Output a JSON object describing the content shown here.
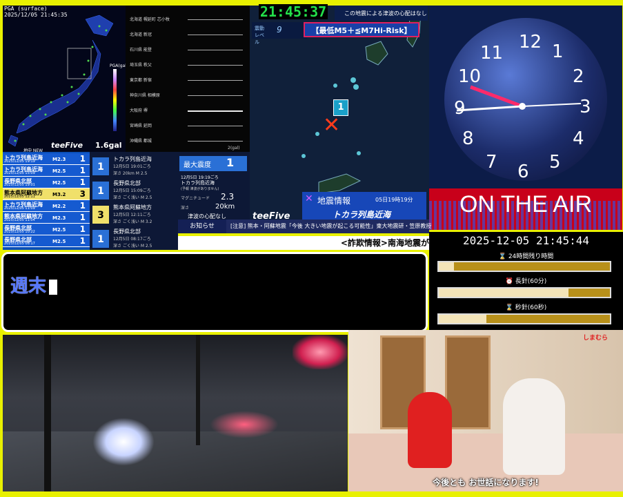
{
  "map_panel": {
    "header": [
      "PGA (surface)",
      "2025/12/05 21:45:35"
    ],
    "legend_title": "PGA(gal)",
    "legend_scale": [
      "1000",
      "100",
      "10",
      "1",
      "0.1",
      "0.01"
    ],
    "reading": "1.6gal",
    "brand": "teeFive",
    "label_new": "地中 NEW"
  },
  "waveform": {
    "stations": [
      "北海道 幌延町 芯小牧",
      "北海道 新冠",
      "石川県 能登",
      "埼玉県 秩父",
      "東京都 新宿",
      "神奈川県 相模原",
      "大阪府 堺",
      "宮崎県 延岡",
      "沖縄県 都城"
    ],
    "footer": "2(gal)"
  },
  "center_map": {
    "clock": "21:45:37",
    "notice": "この地震による津波の心配はなし",
    "level_label": "震動 レベル",
    "level_value": "9",
    "hirisk": "【最低M5＋≦M7Hi-Risk】",
    "intensity_marker": "1",
    "brand": "teeFive",
    "info_title": "地震情報",
    "info_time": "05日19時19分",
    "info_place": "トカラ列島近海"
  },
  "eq_list": [
    {
      "name": "トカラ列島近海",
      "date": "2025/12/05 19:19",
      "mag": "M2.3",
      "shindo": "1",
      "alt": false
    },
    {
      "name": "トカラ列島近海",
      "date": "2025/12/05 15:09",
      "mag": "M2.5",
      "shindo": "1",
      "alt": false
    },
    {
      "name": "長野県北部",
      "date": "2025/12/05 19:01",
      "mag": "M2.5",
      "shindo": "1",
      "alt": false
    },
    {
      "name": "熊本県阿蘇地方",
      "date": "2025/12/05 12:11",
      "mag": "M3.2",
      "shindo": "3",
      "alt": true
    },
    {
      "name": "トカラ列島近海",
      "date": "2025/12/05 11:09",
      "mag": "M2.2",
      "shindo": "1",
      "alt": false
    },
    {
      "name": "熊本県阿蘇地方",
      "date": "2025/12/05 11:04",
      "mag": "M2.3",
      "shindo": "1",
      "alt": false
    },
    {
      "name": "長野県北部",
      "date": "2025/12/05 10:22",
      "mag": "M2.5",
      "shindo": "1",
      "alt": false
    },
    {
      "name": "長野県北部",
      "date": "2025/12/05 08:17",
      "mag": "M2.5",
      "shindo": "1",
      "alt": false
    }
  ],
  "details": [
    {
      "box": "1",
      "yellow": false,
      "place": "トカラ列島近海",
      "time": "12月5日 19:01ごろ",
      "sub": "深さ 20km M 2.5"
    },
    {
      "box": "1",
      "yellow": false,
      "place": "長野県北部",
      "time": "12月5日 15:09ごろ",
      "sub": "深さ ごく浅い M 2.5"
    },
    {
      "box": "3",
      "yellow": true,
      "place": "熊本県阿蘇地方",
      "time": "12月5日 12:11ごろ",
      "sub": "深さ ごく浅い M 3.2"
    },
    {
      "box": "1",
      "yellow": false,
      "place": "長野県北部",
      "time": "12月5日 08:17ごろ",
      "sub": "深さ ごく浅い M 2.5"
    }
  ],
  "max_intensity": {
    "label": "最大震度",
    "value": "1",
    "time": "12月5日 19:19ごろ",
    "place": "トカラ列島近海",
    "tsunami": "(予報 津波がありません)",
    "mag_label": "マグニチュード",
    "mag": "2.3",
    "depth_label": "深さ",
    "depth": "20km",
    "tsunami_note": "津波の心配なし"
  },
  "oshirase": {
    "label": "お知らせ",
    "text": "[注意] 熊本・阿蘇地震「今後 大きい地震が起こる可能性」東大地震研・笠原教授"
  },
  "ticker": "<詐欺情報>南海地震が",
  "clock_panel": {
    "numbers": [
      "12",
      "1",
      "2",
      "3",
      "4",
      "5",
      "6",
      "7",
      "8",
      "9",
      "10",
      "11"
    ],
    "onair": "ON THE AIR",
    "timestamp": "2025-12-05 21:45:44"
  },
  "progress": [
    {
      "label": "24時間残り時間",
      "icon": "hourglass-icon",
      "fraction": 0.09
    },
    {
      "label": "長針(60分)",
      "icon": "clock-icon",
      "fraction": 0.76
    },
    {
      "label": "秒針(60秒)",
      "icon": "hourglass-icon",
      "fraction": 0.28
    }
  ],
  "input_box": {
    "text": "週末"
  },
  "camera_right": {
    "brand": "しまむら",
    "subtitle": "今後とも お世話になります!"
  }
}
